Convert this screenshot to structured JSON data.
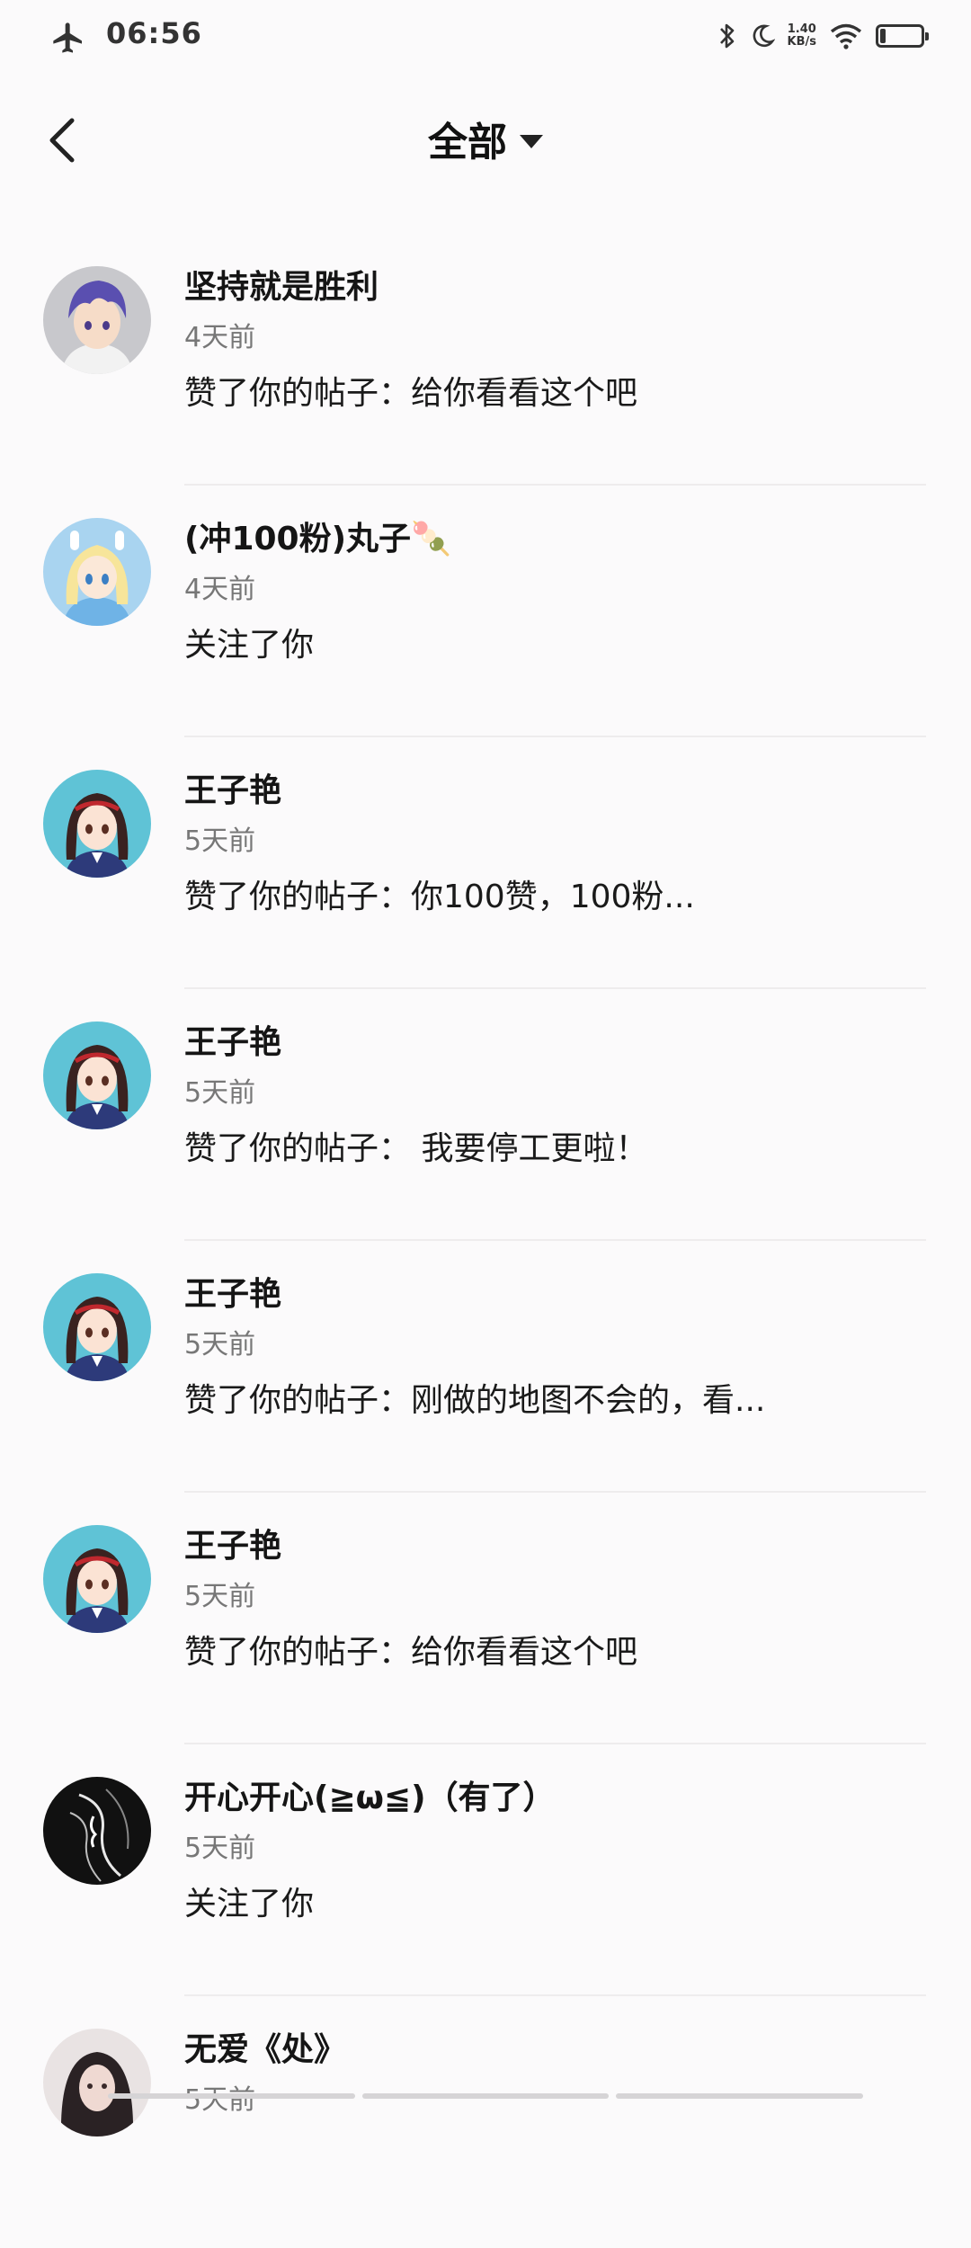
{
  "status_bar": {
    "time": "06:56",
    "net_speed_value": "1.40",
    "net_speed_unit": "KB/s",
    "icons": [
      "airplane-icon",
      "bluetooth-icon",
      "moon-icon",
      "wifi-icon",
      "battery-icon"
    ]
  },
  "header": {
    "title": "全部"
  },
  "notifications": [
    {
      "name": "坚持就是胜利",
      "time": "4天前",
      "message": "赞了你的帖子：给你看看这个吧"
    },
    {
      "name": "(冲100粉)丸子🍡",
      "time": "4天前",
      "message": "关注了你"
    },
    {
      "name": "王子艳",
      "time": "5天前",
      "message": "赞了你的帖子：你100赞，100粉..."
    },
    {
      "name": "王子艳",
      "time": "5天前",
      "message": "赞了你的帖子： 我要停工更啦！"
    },
    {
      "name": "王子艳",
      "time": "5天前",
      "message": "赞了你的帖子：刚做的地图不会的，看..."
    },
    {
      "name": "王子艳",
      "time": "5天前",
      "message": "赞了你的帖子：给你看看这个吧"
    },
    {
      "name": "开心开心(≧ω≦)（有了）",
      "time": "5天前",
      "message": "关注了你"
    },
    {
      "name": "无爱《处》",
      "time": "5天前",
      "message": ""
    }
  ]
}
